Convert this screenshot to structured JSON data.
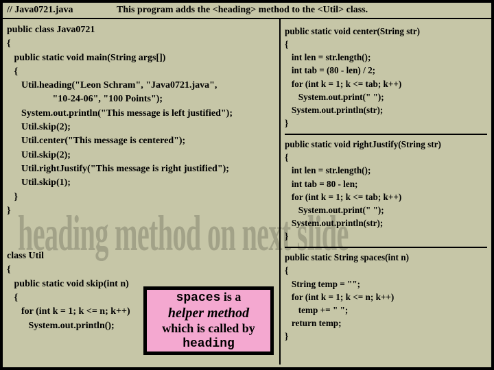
{
  "header": {
    "filename": "// Java0721.java",
    "description": "This program adds the <heading> method to the <Util> class."
  },
  "left": {
    "code_top": "public class Java0721\n{\n   public static void main(String args[])\n   {\n      Util.heading(\"Leon Schram\", \"Java0721.java\",\n                   \"10-24-06\", \"100 Points\");\n      System.out.println(\"This message is left justified\");\n      Util.skip(2);\n      Util.center(\"This message is centered\");\n      Util.skip(2);\n      Util.rightJustify(\"This message is right justified\");\n      Util.skip(1);\n   }\n}",
    "code_bottom": "class Util\n{\n   public static void skip(int n)\n   {\n      for (int k = 1; k <= n; k++)\n         System.out.println();"
  },
  "watermark": "heading method on next slide",
  "callout": {
    "line1a": "spaces",
    "line1b": " is a",
    "line2": "helper method",
    "line3": "which is called by",
    "line4": "heading"
  },
  "right": {
    "block1": "public static void center(String str)\n{\n   int len = str.length();\n   int tab = (80 - len) / 2;\n   for (int k = 1; k <= tab; k++)\n      System.out.print(\" \");\n   System.out.println(str);\n}",
    "block2": "public static void rightJustify(String str)\n{\n   int len = str.length();\n   int tab = 80 - len;\n   for (int k = 1; k <= tab; k++)\n      System.out.print(\" \");\n   System.out.println(str);\n}",
    "block3": "public static String spaces(int n)\n{\n   String temp = \"\";\n   for (int k = 1; k <= n; k++)\n      temp += \" \";\n   return temp;\n}"
  }
}
